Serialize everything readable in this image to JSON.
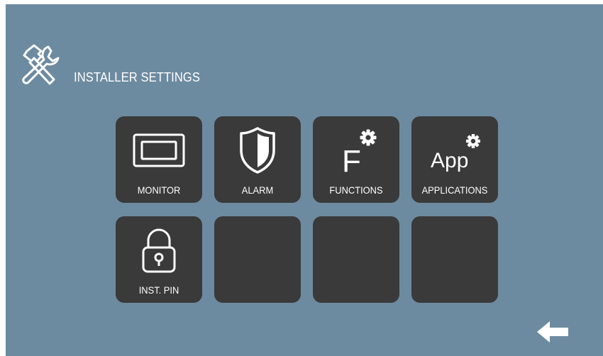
{
  "header": {
    "title": "INSTALLER SETTINGS",
    "icon": "tools-icon"
  },
  "tiles": [
    {
      "label": "MONITOR",
      "icon": "monitor-icon"
    },
    {
      "label": "ALARM",
      "icon": "shield-icon"
    },
    {
      "label": "FUNCTIONS",
      "icon": "functions-gear-icon",
      "glyph": "F"
    },
    {
      "label": "APPLICATIONS",
      "icon": "app-gear-icon",
      "glyph": "App"
    },
    {
      "label": "INST. PIN",
      "icon": "lock-icon"
    },
    {
      "label": "",
      "icon": ""
    },
    {
      "label": "",
      "icon": ""
    },
    {
      "label": "",
      "icon": ""
    }
  ],
  "footer": {
    "back_icon": "back-arrow-icon"
  },
  "colors": {
    "background": "#6d8ba0",
    "tile": "#3a3a3a",
    "foreground": "#ffffff"
  }
}
